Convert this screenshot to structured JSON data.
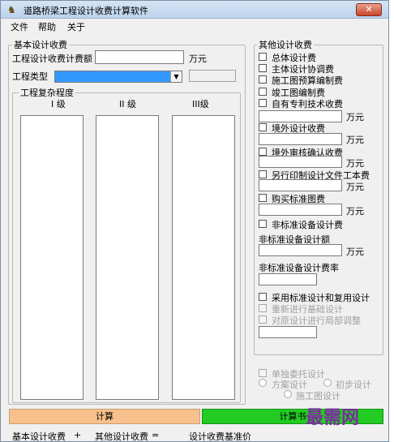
{
  "window": {
    "title": "道路桥梁工程设计收费计算软件",
    "close_glyph": "✕"
  },
  "menu": {
    "items": [
      "文件",
      "帮助",
      "关于"
    ]
  },
  "basic": {
    "group_title": "基本设计收费",
    "fee_base_label": "工程设计收费计费额",
    "fee_base_value": "",
    "fee_unit": "万元",
    "project_type_label": "工程类型",
    "project_type_value": "",
    "complexity": {
      "group_title": "工程复杂程度",
      "levels": [
        "I 级",
        "II 级",
        "III级"
      ]
    }
  },
  "other": {
    "group_title": "其他设计收费",
    "items": [
      {
        "label": "总体设计费",
        "checked": false
      },
      {
        "label": "主体设计协调费",
        "checked": false
      },
      {
        "label": "施工图预算编制费",
        "checked": false
      },
      {
        "label": "竣工图编制费",
        "checked": false
      },
      {
        "label": "自有专利技术收费",
        "checked": false
      },
      {
        "label": "境外设计收费",
        "checked": false
      },
      {
        "label": "境外审核确认收费",
        "checked": false
      },
      {
        "label": "另行印制设计文件工本费",
        "checked": false
      },
      {
        "label": "购买标准图费",
        "checked": false
      },
      {
        "label": "非标准设备设计费",
        "checked": false
      }
    ],
    "unit": "万元",
    "nonstd_fee_label": "非标准设备设计额",
    "nonstd_rate_label": "非标准设备设计费率",
    "std_design_label": "采用标准设计和复用设计",
    "redo_foundation_label": "重新进行基础设计",
    "partial_adjust_label": "对原设计进行局部调整"
  },
  "entrust": {
    "single_label": "单独委托设计",
    "scheme_label": "方案设计",
    "prelim_label": "初步设计",
    "construction_label": "施工图设计"
  },
  "actions": {
    "calc_label": "计算",
    "calc_book_label": "计算书"
  },
  "watermark": "最需网",
  "status": {
    "basic_label": "基本设计收费",
    "plus": "+",
    "other_label": "其他设计收费",
    "equals": "=",
    "base_price_label": "设计收费基准价"
  }
}
